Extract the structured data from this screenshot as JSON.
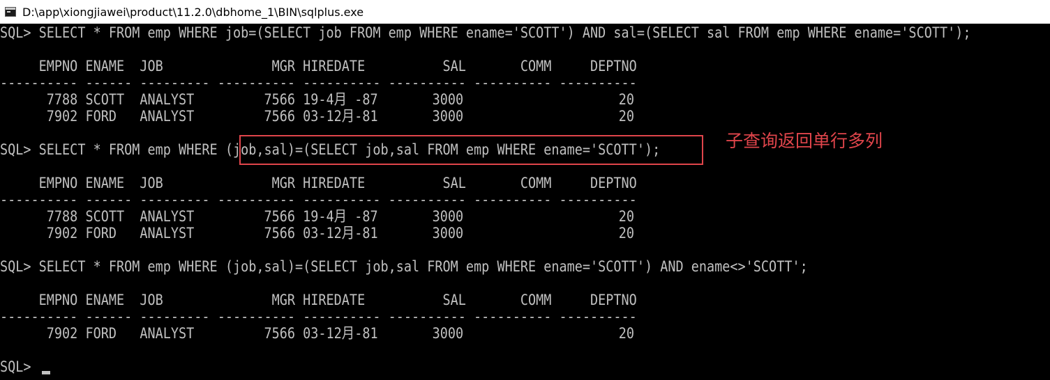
{
  "window": {
    "title": "D:\\app\\xiongjiawei\\product\\11.2.0\\dbhome_1\\BIN\\sqlplus.exe",
    "icon": "console-app-icon"
  },
  "colors": {
    "background": "#000000",
    "text": "#c0c0c0",
    "annotation": "#e0454b"
  },
  "console": {
    "lines": [
      "SQL> SELECT * FROM emp WHERE job=(SELECT job FROM emp WHERE ename='SCOTT') AND sal=(SELECT sal FROM emp WHERE ename='SCOTT');",
      "     EMPNO ENAME  JOB              MGR HIREDATE          SAL       COMM     DEPTNO",
      "---------- ------ --------- ---------- ---------- ---------- ---------- ----------",
      "      7788 SCOTT  ANALYST         7566 19-4月 -87       3000                    20",
      "      7902 FORD   ANALYST         7566 03-12月-81       3000                    20",
      "SQL> SELECT * FROM emp WHERE (job,sal)=(SELECT job,sal FROM emp WHERE ename='SCOTT');",
      "     EMPNO ENAME  JOB              MGR HIREDATE          SAL       COMM     DEPTNO",
      "---------- ------ --------- ---------- ---------- ---------- ---------- ----------",
      "      7788 SCOTT  ANALYST         7566 19-4月 -87       3000                    20",
      "      7902 FORD   ANALYST         7566 03-12月-81       3000                    20",
      "SQL> SELECT * FROM emp WHERE (job,sal)=(SELECT job,sal FROM emp WHERE ename='SCOTT') AND ename<>'SCOTT';",
      "     EMPNO ENAME  JOB              MGR HIREDATE          SAL       COMM     DEPTNO",
      "---------- ------ --------- ---------- ---------- ---------- ---------- ----------",
      "      7902 FORD   ANALYST         7566 03-12月-81       3000                    20",
      "SQL>"
    ]
  },
  "annotation": {
    "text": "子查询返回单行多列"
  }
}
